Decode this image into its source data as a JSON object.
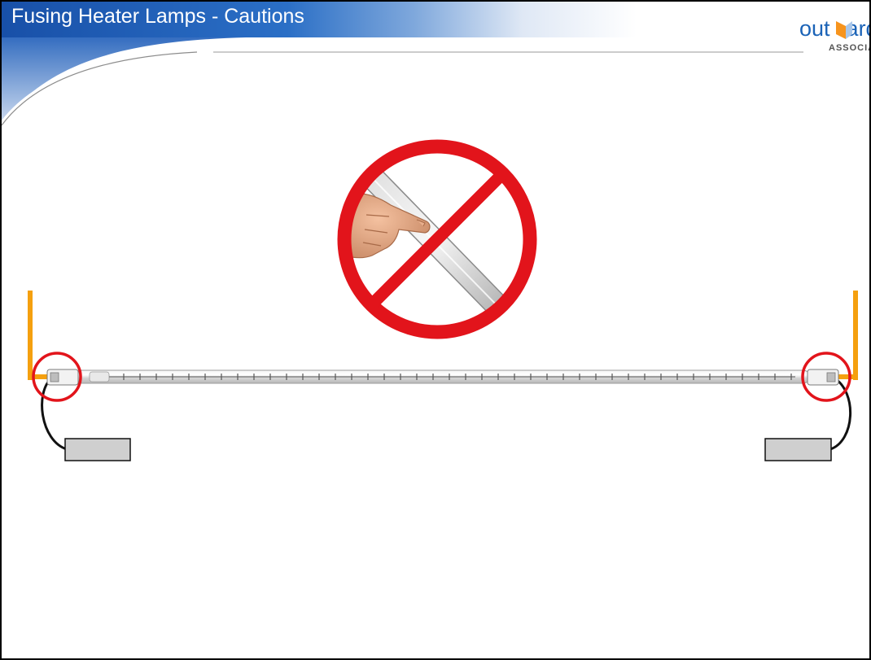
{
  "slide": {
    "title": "Fusing Heater Lamps - Cautions"
  },
  "logo": {
    "text_left": "out",
    "text_right": "ard",
    "subtitle": "ASSOCIATES"
  },
  "colors": {
    "header_blue": "#1d5fb5",
    "no_sign_red": "#e2141b",
    "bracket_orange": "#f5a00f",
    "logo_blue": "#1b63b7",
    "logo_orange": "#f7941d"
  },
  "icons": {
    "prohibited": "no-touch-prohibition-sign",
    "lamp": "fusing-heater-lamp"
  }
}
